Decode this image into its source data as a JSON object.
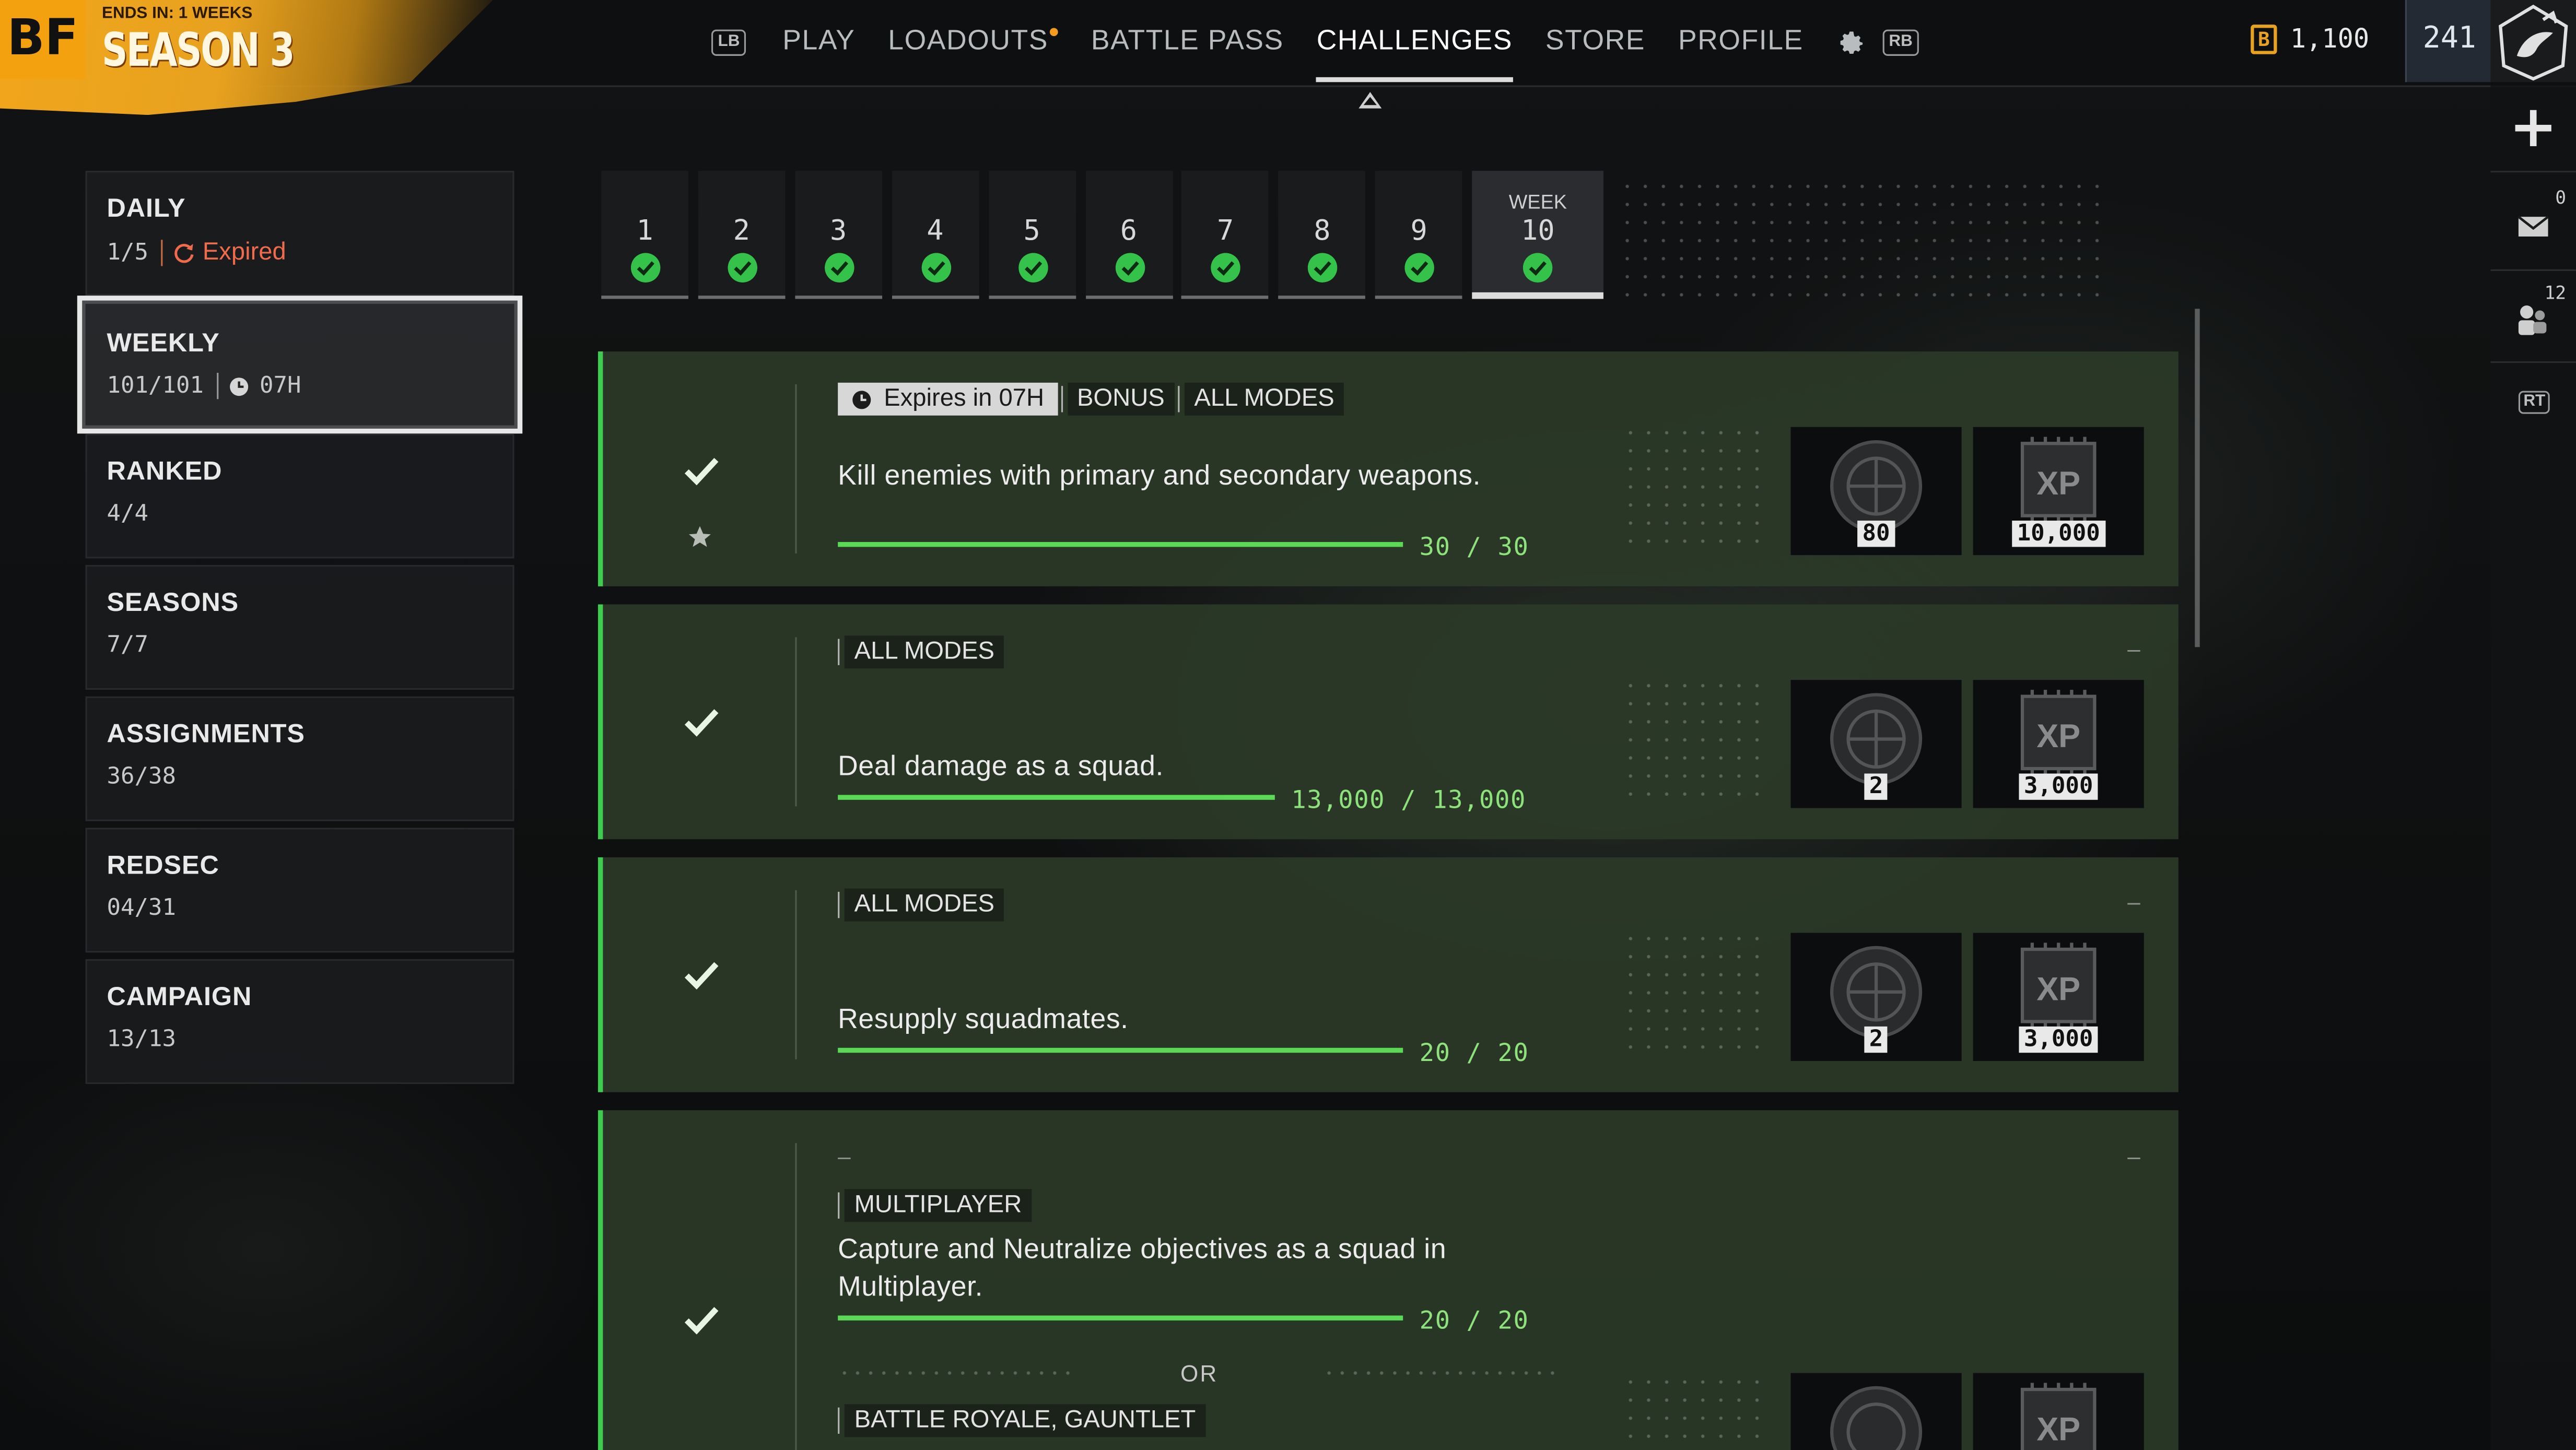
{
  "header": {
    "logo": "BF",
    "ends_in": "ENDS IN:  1 WEEKS",
    "season": "SEASON 3",
    "hint_left": "LB",
    "hint_right": "RB",
    "nav": [
      "PLAY",
      "LOADOUTS",
      "BATTLE PASS",
      "CHALLENGES",
      "STORE",
      "PROFILE"
    ],
    "active_nav": "CHALLENGES",
    "currency_symbol": "B",
    "currency": "1,100",
    "level": "241"
  },
  "rail": {
    "mail_count": "0",
    "squad_count": "12",
    "rt_hint": "RT"
  },
  "sidebar": [
    {
      "title": "DAILY",
      "progress": "1/5",
      "status": "Expired"
    },
    {
      "title": "WEEKLY",
      "progress": "101/101",
      "timer": "07H"
    },
    {
      "title": "RANKED",
      "progress": "4/4"
    },
    {
      "title": "SEASONS",
      "progress": "7/7"
    },
    {
      "title": "ASSIGNMENTS",
      "progress": "36/38"
    },
    {
      "title": "REDSEC",
      "progress": "04/31"
    },
    {
      "title": "CAMPAIGN",
      "progress": "13/13"
    }
  ],
  "weeks": {
    "label": "WEEK",
    "items": [
      "1",
      "2",
      "3",
      "4",
      "5",
      "6",
      "7",
      "8",
      "9",
      "10"
    ],
    "selected": "10"
  },
  "challenges": [
    {
      "expires": "Expires in 07H",
      "tags": [
        "BONUS",
        "ALL MODES"
      ],
      "description": "Kill enemies with primary and secondary weapons.",
      "progress_text": "30 / 30",
      "progress": 1.0,
      "rewards": [
        "80",
        "10,000"
      ]
    },
    {
      "tags": [
        "ALL MODES"
      ],
      "description": "Deal damage as a squad.",
      "progress_text": "13,000 / 13,000",
      "progress": 1.0,
      "rewards": [
        "2",
        "3,000"
      ],
      "dash": "–"
    },
    {
      "tags": [
        "ALL MODES"
      ],
      "description": "Resupply squadmates.",
      "progress_text": "20 / 20",
      "progress": 1.0,
      "rewards": [
        "2",
        "3,000"
      ],
      "dash": "–"
    },
    {
      "tags": [
        "MULTIPLAYER"
      ],
      "description": "Capture and Neutralize objectives as a squad in Multiplayer.",
      "progress_text": "20 / 20",
      "progress": 1.0,
      "or_label": "OR",
      "alt_tags": [
        "BATTLE ROYALE, GAUNTLET"
      ],
      "dash": "–",
      "reward_label": "XP"
    }
  ],
  "colors": {
    "accent_green": "#3fcb4f",
    "check_green": "#35c24a",
    "progress_text": "#8ee27c",
    "expired_red": "#f06b4c",
    "season_orange": "#f1a51c"
  }
}
